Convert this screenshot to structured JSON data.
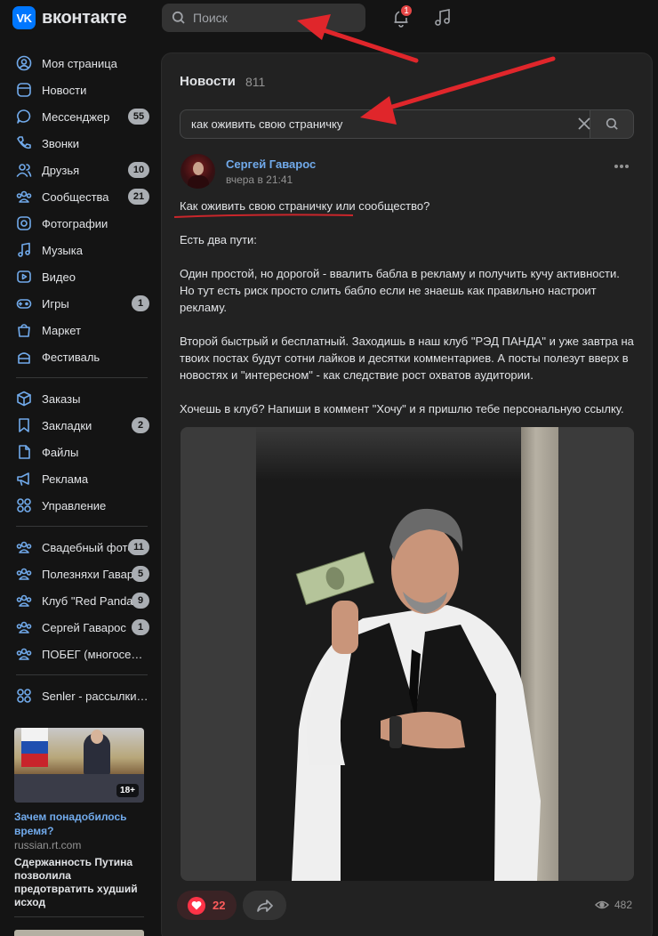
{
  "header": {
    "logo_mark": "VK",
    "logo_text": "вконтакте",
    "search_placeholder": "Поиск",
    "notifications_count": "1"
  },
  "sidebar": {
    "items": [
      {
        "label": "Моя страница",
        "icon": "user-circle-icon",
        "count": ""
      },
      {
        "label": "Новости",
        "icon": "newsfeed-icon",
        "count": ""
      },
      {
        "label": "Мессенджер",
        "icon": "message-icon",
        "count": "55"
      },
      {
        "label": "Звонки",
        "icon": "phone-icon",
        "count": ""
      },
      {
        "label": "Друзья",
        "icon": "friends-icon",
        "count": "10"
      },
      {
        "label": "Сообщества",
        "icon": "communities-icon",
        "count": "21"
      },
      {
        "label": "Фотографии",
        "icon": "photo-icon",
        "count": ""
      },
      {
        "label": "Музыка",
        "icon": "music-icon",
        "count": ""
      },
      {
        "label": "Видео",
        "icon": "video-icon",
        "count": ""
      },
      {
        "label": "Игры",
        "icon": "gamepad-icon",
        "count": "1"
      },
      {
        "label": "Маркет",
        "icon": "bag-icon",
        "count": ""
      },
      {
        "label": "Фестиваль",
        "icon": "festival-icon",
        "count": ""
      }
    ],
    "items2": [
      {
        "label": "Заказы",
        "icon": "box-icon",
        "count": ""
      },
      {
        "label": "Закладки",
        "icon": "bookmark-icon",
        "count": "2"
      },
      {
        "label": "Файлы",
        "icon": "file-icon",
        "count": ""
      },
      {
        "label": "Реклама",
        "icon": "megaphone-icon",
        "count": ""
      },
      {
        "label": "Управление",
        "icon": "grid-icon",
        "count": ""
      }
    ],
    "groups": [
      {
        "label": "Свадебный фотограф",
        "count": "11"
      },
      {
        "label": "Полезняхи Гаварос",
        "count": "5"
      },
      {
        "label": "Клуб \"Red Panda\"",
        "count": "9"
      },
      {
        "label": "Сергей Гаварос",
        "count": "1"
      },
      {
        "label": "ПОБЕГ (многосерийный)",
        "count": ""
      }
    ],
    "app": {
      "label": "Senler - рассылки ВКонтакте"
    },
    "ad": {
      "age": "18+",
      "title": "Зачем понадобилось время?",
      "source": "russian.rt.com",
      "text": "Сдержанность Путина позволила предотвратить худший исход"
    }
  },
  "feed": {
    "title": "Новости",
    "count": "811",
    "search_value": "как оживить свою страничку",
    "post": {
      "author": "Сергей Гаварос",
      "time": "вчера в 21:41",
      "paragraphs": [
        "Как оживить свою страничку или сообщество?",
        "Есть два пути:",
        "Один простой, но дорогой - ввалить бабла в рекламу и получить кучу активности. Но тут есть риск просто слить бабло если не знаешь как правильно настроит рекламу.",
        "Второй быстрый и бесплатный. Заходишь в наш клуб \"РЭД ПАНДА\" и уже завтра на твоих постах будут сотни лайков и десятки комментариев. А посты полезут вверх в новостях и \"интересном\" - как следствие рост охватов аудитории.",
        "Хочешь в клуб? Напиши в коммент \"Хочу\" и я пришлю тебе персональную ссылку."
      ],
      "likes": "22",
      "views": "482"
    }
  },
  "colors": {
    "accent": "#71aaeb",
    "brand": "#0077ff",
    "annotation": "#e0262b"
  }
}
